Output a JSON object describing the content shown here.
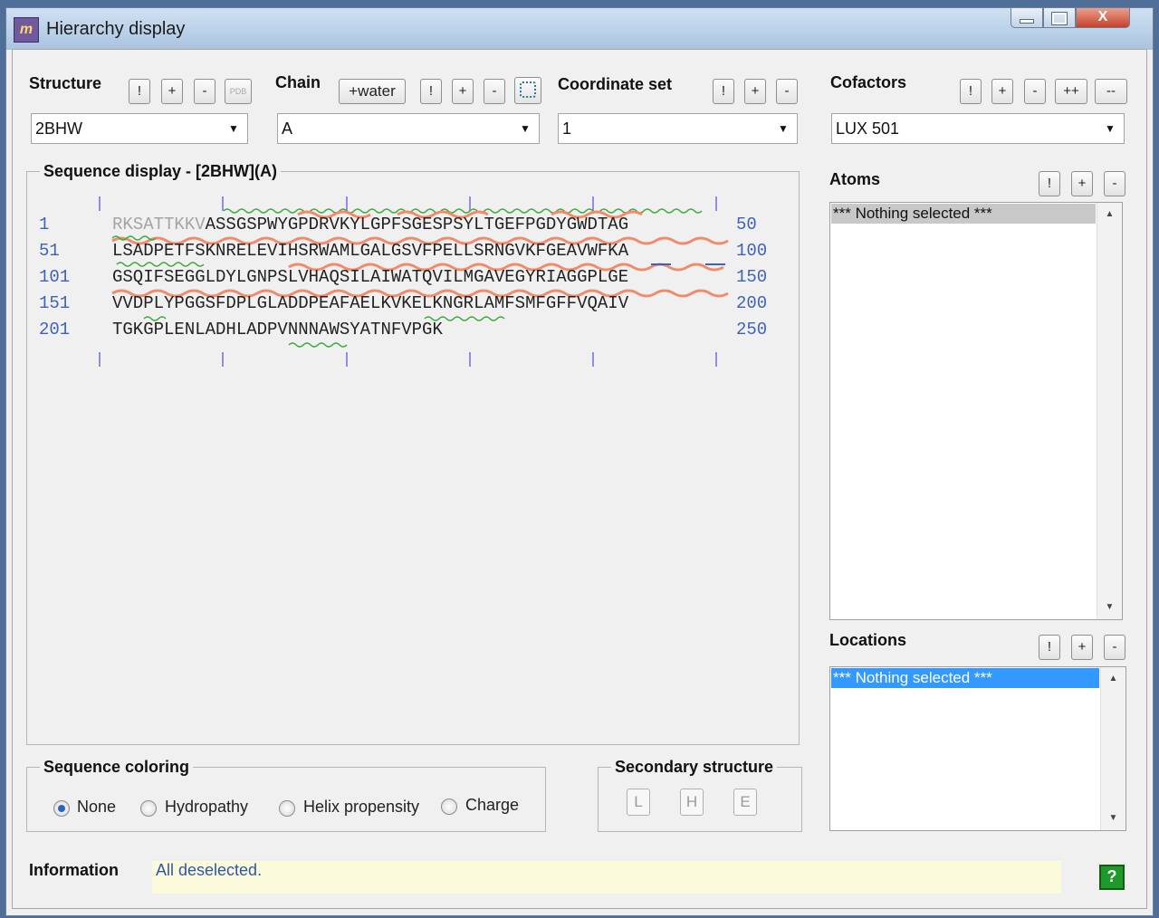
{
  "window": {
    "title": "Hierarchy display",
    "app_icon_glyph": "m",
    "close_glyph": "X"
  },
  "structure": {
    "label": "Structure",
    "buttons": [
      "!",
      "+",
      "-"
    ],
    "pdb_icon_label": "PDB",
    "value": "2BHW"
  },
  "chain": {
    "label": "Chain",
    "water_button": "+water",
    "buttons": [
      "!",
      "+",
      "-"
    ],
    "value": "A"
  },
  "coordinate_set": {
    "label": "Coordinate set",
    "buttons": [
      "!",
      "+",
      "-"
    ],
    "value": "1"
  },
  "cofactors": {
    "label": "Cofactors",
    "buttons": [
      "!",
      "+",
      "-",
      "++",
      "--"
    ],
    "value": "LUX 501"
  },
  "sequence_display": {
    "title": "Sequence display - [2BHW](A)",
    "rows": [
      {
        "start": "1",
        "end": "50",
        "greyed": "RKSATTKKV",
        "seq": "ASSGSPWYGPDRVKYLGPFSGESPSYLTGEFPGDYGWDTAG"
      },
      {
        "start": "51",
        "end": "100",
        "greyed": "",
        "seq": "LSADPETFSKNRELEVIHSRWAMLGALGSVFPELLSRNGVKFGEAVWFKA"
      },
      {
        "start": "101",
        "end": "150",
        "greyed": "",
        "seq": "GSQIFSEGGLDYLGNPSLVHAQSILAIWATQVILMGAVEGYRIAGGPLGE"
      },
      {
        "start": "151",
        "end": "200",
        "greyed": "",
        "seq": "VVDPLYPGGSFDPLGLADDPEAFAELKVKELKNGRLAMFSMFGFFVQAIV"
      },
      {
        "start": "201",
        "end": "250",
        "greyed": "",
        "seq": "TGKGPLENLADHLADPVNNNAWSYATNFVPGK"
      }
    ]
  },
  "atoms": {
    "label": "Atoms",
    "buttons": [
      "!",
      "+",
      "-"
    ],
    "items": [
      "*** Nothing selected ***"
    ]
  },
  "locations": {
    "label": "Locations",
    "buttons": [
      "!",
      "+",
      "-"
    ],
    "items": [
      "*** Nothing selected ***"
    ]
  },
  "sequence_coloring": {
    "title": "Sequence coloring",
    "options": [
      "None",
      "Hydropathy",
      "Helix propensity",
      "Charge"
    ],
    "selected": "None"
  },
  "secondary_structure": {
    "title": "Secondary structure",
    "buttons": [
      "L",
      "H",
      "E"
    ]
  },
  "information": {
    "label": "Information",
    "text": "All deselected.",
    "help_icon": "?"
  },
  "colors": {
    "accent": "#3399ff",
    "row_number": "#3f62b8",
    "helix_wave": "#f28b6b",
    "strand_wave": "#3faa3f",
    "info_bg": "#fbfbdc",
    "help_green": "#1f9a2a"
  }
}
